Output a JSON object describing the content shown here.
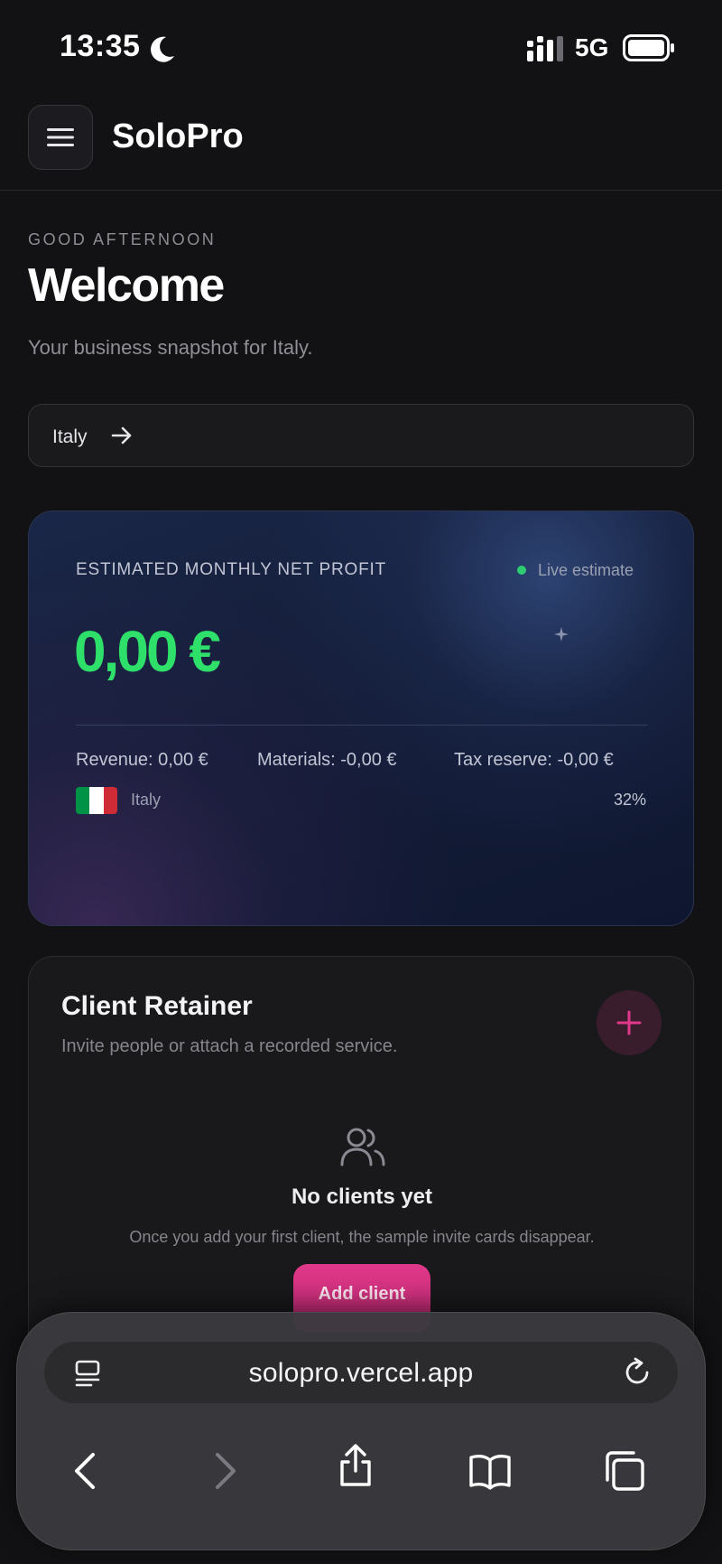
{
  "status_bar": {
    "time": "13:35",
    "network": "5G",
    "icons": [
      "moon-icon",
      "signal-icon",
      "battery-icon"
    ]
  },
  "header": {
    "app_title": "SoloPro",
    "menu_icon": "hamburger-menu-icon"
  },
  "greeting": {
    "eyebrow": "GOOD AFTERNOON",
    "title": "Welcome",
    "subtitle": "Your business snapshot for Italy."
  },
  "country_selector": {
    "label": "Italy",
    "icon": "arrow-right-icon"
  },
  "profit_card": {
    "label": "ESTIMATED MONTHLY NET PROFIT",
    "live_label": "Live estimate",
    "value": "0,00 €",
    "revenue": "Revenue: 0,00 €",
    "materials": "Materials: -0,00 €",
    "tax_reserve": "Tax reserve: -0,00 €",
    "country": "Italy",
    "tax_rate": "32%",
    "colors": {
      "profit": "#2ee06a",
      "live_dot": "#2ecc71",
      "flag_green": "#009246",
      "flag_white": "#ffffff",
      "flag_red": "#ce2b37"
    }
  },
  "client_card": {
    "title": "Client Retainer",
    "subtitle": "Invite people or attach a recorded service.",
    "empty_title": "No clients yet",
    "empty_description": "Once you add your first client, the sample invite cards disappear.",
    "add_button_label": "Add client",
    "colors": {
      "accent": "#e0388a"
    }
  },
  "browser": {
    "url": "solopro.vercel.app",
    "icons": [
      "reader-icon",
      "reload-icon",
      "back-icon",
      "forward-icon",
      "share-icon",
      "bookmarks-icon",
      "tabs-icon"
    ]
  }
}
